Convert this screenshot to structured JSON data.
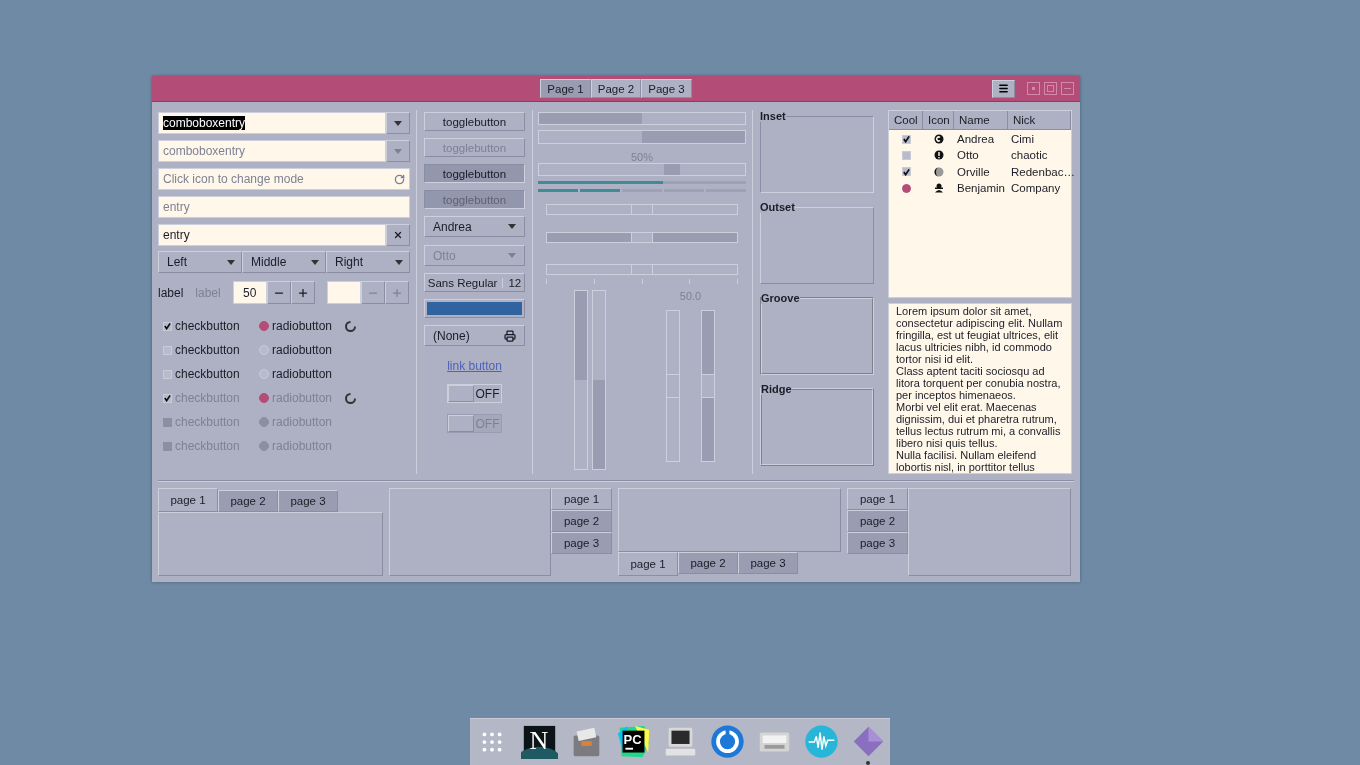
{
  "window": {
    "tabs": [
      {
        "label": "Page 1",
        "selected": true
      },
      {
        "label": "Page 2",
        "selected": false
      },
      {
        "label": "Page 3",
        "selected": false
      }
    ]
  },
  "entries": [
    {
      "kind": "combo",
      "value": "comboboxentry",
      "highlighted": true,
      "disabled": false
    },
    {
      "kind": "combo",
      "value": "comboboxentry",
      "highlighted": false,
      "disabled": true
    },
    {
      "kind": "icon",
      "placeholder": "Click icon to change mode"
    },
    {
      "kind": "plain",
      "placeholder": "entry"
    },
    {
      "kind": "clear",
      "value": "entry"
    }
  ],
  "align_combos": [
    "Left",
    "Middle",
    "Right"
  ],
  "labels": [
    {
      "text": "label",
      "disabled": false
    },
    {
      "text": "label",
      "disabled": true
    }
  ],
  "spin_buttons": [
    {
      "value": "50",
      "disabled": false
    },
    {
      "disabled": true
    }
  ],
  "check_rows": [
    {
      "check": {
        "kind": "normal",
        "label": "checkbutton",
        "checked": true,
        "disabled": false
      },
      "radio": {
        "kind": "normal",
        "label": "radiobutton",
        "selected": true,
        "disabled": false
      },
      "spinner": true
    },
    {
      "check": {
        "kind": "normal",
        "label": "checkbutton",
        "checked": false,
        "disabled": false
      },
      "radio": {
        "kind": "normal",
        "label": "radiobutton",
        "selected": false,
        "disabled": false
      },
      "spinner": false
    },
    {
      "check": {
        "kind": "normal",
        "label": "checkbutton",
        "checked": false,
        "disabled": false
      },
      "radio": {
        "kind": "normal",
        "label": "radiobutton",
        "selected": false,
        "disabled": false
      },
      "spinner": false
    },
    {
      "check": {
        "kind": "normal",
        "label": "checkbutton",
        "checked": true,
        "disabled": true
      },
      "radio": {
        "kind": "normal",
        "label": "radiobutton",
        "selected": true,
        "disabled": true
      },
      "spinner": true
    },
    {
      "check": {
        "kind": "inconsistent",
        "label": "checkbutton",
        "checked": false,
        "disabled": true
      },
      "radio": {
        "kind": "inconsistent",
        "label": "radiobutton",
        "selected": false,
        "disabled": true
      },
      "spinner": false
    },
    {
      "check": {
        "kind": "inconsistent",
        "label": "checkbutton",
        "checked": false,
        "disabled": true
      },
      "radio": {
        "kind": "inconsistent",
        "label": "radiobutton",
        "selected": false,
        "disabled": true
      },
      "spinner": false
    }
  ],
  "toggle_buttons": [
    {
      "label": "togglebutton",
      "active": false,
      "disabled": false
    },
    {
      "label": "togglebutton",
      "active": false,
      "disabled": true
    },
    {
      "label": "togglebutton",
      "active": true,
      "disabled": false
    },
    {
      "label": "togglebutton",
      "active": true,
      "disabled": true
    }
  ],
  "combo_boxes": [
    {
      "value": "Andrea",
      "disabled": false
    },
    {
      "value": "Otto",
      "disabled": true
    }
  ],
  "font_button": {
    "family": "Sans Regular",
    "size": "12"
  },
  "file_button": {
    "value": "(None)"
  },
  "link_button": {
    "label": "link button"
  },
  "switches": [
    {
      "label": "OFF",
      "on": false,
      "disabled": false
    },
    {
      "label": "OFF",
      "on": false,
      "disabled": true
    }
  ],
  "progress_bars": [
    {
      "level": 0.5,
      "inverted": false
    },
    {
      "level": 0.5,
      "inverted": true
    }
  ],
  "pulse_bar": {
    "text": "50%"
  },
  "level_bars": [
    {
      "kind": "continuous",
      "level": 0.6
    },
    {
      "kind": "discrete",
      "level": 0.4
    }
  ],
  "scales": [
    {
      "level": 0.5,
      "marks": false
    },
    {
      "level": 0.5,
      "marks": false
    },
    {
      "level": 0.5,
      "marks": true
    }
  ],
  "vertical_progress": [
    {
      "level": 0.5,
      "kind": "inverted"
    },
    {
      "level": 0.5,
      "kind": "normal"
    }
  ],
  "vertical_scales": {
    "value": "50.0",
    "items": [
      {
        "level": 0.5
      },
      {
        "level": 0.5
      }
    ]
  },
  "frames": [
    {
      "label": "Inset",
      "kind": "inset"
    },
    {
      "label": "Outset",
      "kind": "outset"
    },
    {
      "label": "Groove",
      "kind": "groove"
    },
    {
      "label": "Ridge",
      "kind": "ridge"
    }
  ],
  "tree": {
    "columns": [
      "Cool",
      "Icon",
      "Name",
      "Nick"
    ],
    "rows": [
      {
        "kind": "check",
        "checked": true,
        "name": "Andrea",
        "nick": "Cimi"
      },
      {
        "kind": "check",
        "checked": false,
        "name": "Otto",
        "nick": "chaotic"
      },
      {
        "kind": "check",
        "checked": true,
        "name": "Orville",
        "nick": "Redenbac…"
      },
      {
        "kind": "radio",
        "checked": true,
        "name": "Benjamin",
        "nick": "Company"
      }
    ]
  },
  "text_view": [
    "Lorem ipsum dolor sit amet, consectetur adipiscing elit. Nullam fringilla, est ut feugiat ultrices, elit lacus ultricies nibh, id commodo tortor nisi id elit.",
    "Class aptent taciti sociosqu ad litora torquent per conubia nostra, per inceptos himenaeos.",
    "Morbi vel elit erat. Maecenas dignissim, dui et pharetra rutrum, tellus lectus rutrum mi, a convallis libero nisi quis tellus.",
    "Nulla facilisi. Nullam eleifend lobortis nisl, in porttitor tellus"
  ],
  "notebooks": [
    {
      "kind": "top",
      "tabs": [
        {
          "label": "page 1",
          "selected": true
        },
        {
          "label": "page 2",
          "selected": false
        },
        {
          "label": "page 3",
          "selected": false
        }
      ]
    },
    {
      "kind": "right",
      "tabs": [
        {
          "label": "page 1",
          "selected": true
        },
        {
          "label": "page 2",
          "selected": false
        },
        {
          "label": "page 3",
          "selected": false
        }
      ]
    },
    {
      "kind": "bottom",
      "tabs": [
        {
          "label": "page 1",
          "selected": true
        },
        {
          "label": "page 2",
          "selected": false
        },
        {
          "label": "page 3",
          "selected": false
        }
      ]
    },
    {
      "kind": "left",
      "tabs": [
        {
          "label": "page 1",
          "selected": true
        },
        {
          "label": "page 2",
          "selected": false
        },
        {
          "label": "page 3",
          "selected": false
        }
      ]
    }
  ],
  "dock": [
    {
      "running": false
    },
    {
      "label": "N",
      "running": false
    },
    {
      "running": false
    },
    {
      "label": "PC",
      "running": false
    },
    {
      "running": false
    },
    {
      "running": false
    },
    {
      "running": false
    },
    {
      "running": false
    },
    {
      "running": true
    }
  ]
}
